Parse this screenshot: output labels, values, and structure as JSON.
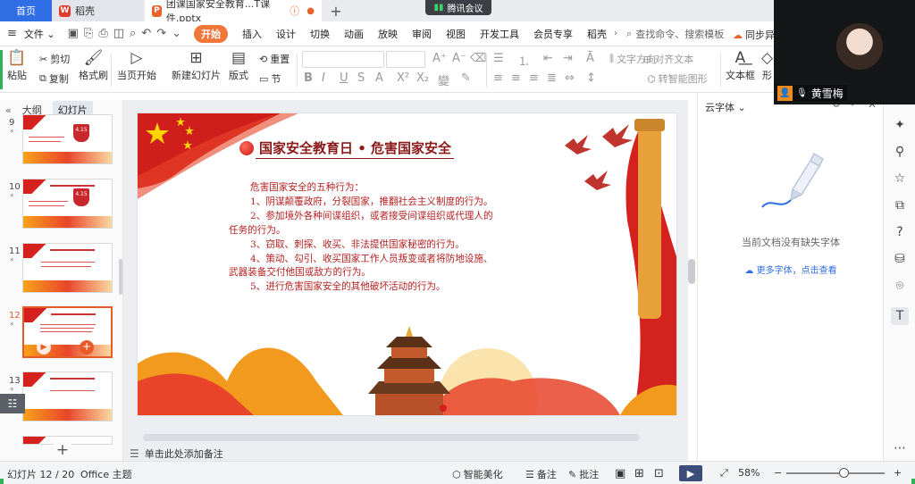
{
  "tabs": {
    "home": "首页",
    "daoke": "稻壳",
    "doc": "团课国家安全教育...T课件.pptx",
    "add": "+"
  },
  "meeting": {
    "label": "腾讯会议"
  },
  "menu": {
    "file": "文件",
    "items": [
      "开始",
      "插入",
      "设计",
      "切换",
      "动画",
      "放映",
      "审阅",
      "视图",
      "开发工具",
      "会员专享",
      "稻壳"
    ],
    "search": "查找命令、搜索模板",
    "sync": "同步异"
  },
  "ribbon": {
    "paste": "粘贴",
    "cut": "剪切",
    "copy": "复制",
    "format_brush": "格式刷",
    "from_current": "当页开始",
    "new_slide": "新建幻灯片",
    "layout": "版式",
    "section": "节",
    "reset": "重置",
    "text_direction": "文字方向",
    "align_text": "对齐文本",
    "smart_graphic": "转智能图形",
    "textbox": "文本框",
    "shape": "形"
  },
  "left_pane": {
    "tab_outline": "大纲",
    "tab_slides": "幻灯片",
    "slides": [
      {
        "num": "9",
        "star": "*"
      },
      {
        "num": "10",
        "star": "*"
      },
      {
        "num": "11",
        "star": "*"
      },
      {
        "num": "12",
        "star": "*"
      },
      {
        "num": "13",
        "star": "*"
      }
    ],
    "badge_text": "4.15",
    "add": "+"
  },
  "slide": {
    "title": "国家安全教育日 • 危害国家安全",
    "lines": [
      "危害国家安全的五种行为：",
      "1、阴谋颠覆政府，分裂国家，推翻社会主义制度的行为。",
      "2、参加境外各种间谍组织，或者接受间谍组织或代理人的",
      "任务的行为。",
      "3、窃取、刺探、收买、非法提供国家秘密的行为。",
      "4、策动、勾引、收买国家工作人员叛变或者将防地设施、",
      "武器装备交付他国或敌方的行为。",
      "5、进行危害国家安全的其他破坏活动的行为。"
    ]
  },
  "notes": {
    "placeholder": "单击此处添加备注"
  },
  "right_pane": {
    "title": "云字体",
    "message": "当前文档没有缺失字体",
    "link": "更多字体，点击查看"
  },
  "status": {
    "slide_counter": "幻灯片 12 / 20",
    "theme": "Office 主题",
    "beautify": "智能美化",
    "notes": "备注",
    "comments": "批注",
    "zoom": "58%",
    "zoom_level": 0.58
  },
  "video": {
    "name": "黄雪梅"
  },
  "colors": {
    "accent": "#2f6ee5",
    "start_tab": "#f0763a",
    "slide_title": "#8b1a1a",
    "slide_text": "#b52222"
  }
}
